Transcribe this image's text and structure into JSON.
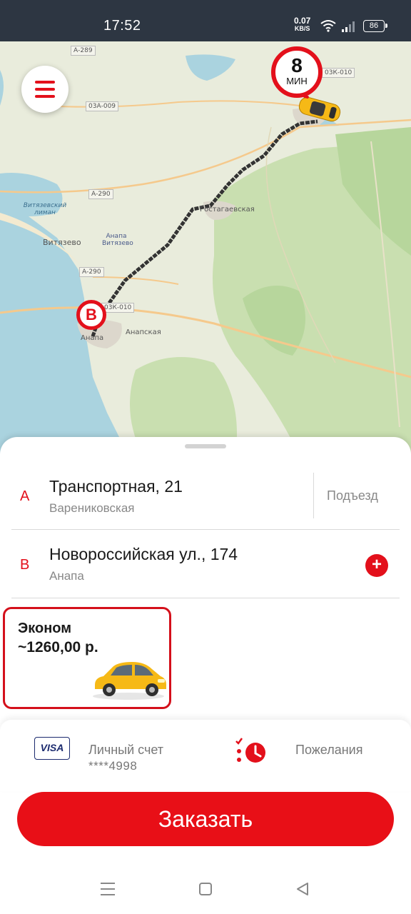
{
  "status_bar": {
    "time": "17:52",
    "net_speed": "0.07",
    "net_unit": "KB/S",
    "battery": "86"
  },
  "map": {
    "eta_value": "8",
    "eta_unit": "МИН",
    "point_b_label": "B",
    "labels": {
      "vityazevo": "Витязево",
      "liman": "Витязевский лиман",
      "airport": "Анапа Витязево",
      "anapa": "Анапа",
      "anapskaya": "Анапская",
      "gostagaevskaya": "Гостагаевская"
    },
    "roads": {
      "r1": "А-289",
      "r2": "03А-009",
      "r3": "А-290",
      "r4": "А-290",
      "r5": "03К-010",
      "r6": "03К-010"
    }
  },
  "route": {
    "point_a": {
      "letter": "A",
      "title": "Транспортная, 21",
      "subtitle": "Варениковская",
      "entrance_label": "Подъезд"
    },
    "point_b": {
      "letter": "B",
      "title": "Новороссийская ул., 174",
      "subtitle": "Анапа",
      "add_label": "+"
    }
  },
  "tariff": {
    "name": "Эконом",
    "price": "~1260,00 р."
  },
  "payment": {
    "card_brand": "VISA",
    "label": "Личный счет",
    "card_number": "****4998",
    "wishes_label": "Пожелания"
  },
  "order_button": "Заказать",
  "colors": {
    "accent": "#e3101b",
    "status_bar": "#2d3642",
    "route_line": "#333333"
  }
}
